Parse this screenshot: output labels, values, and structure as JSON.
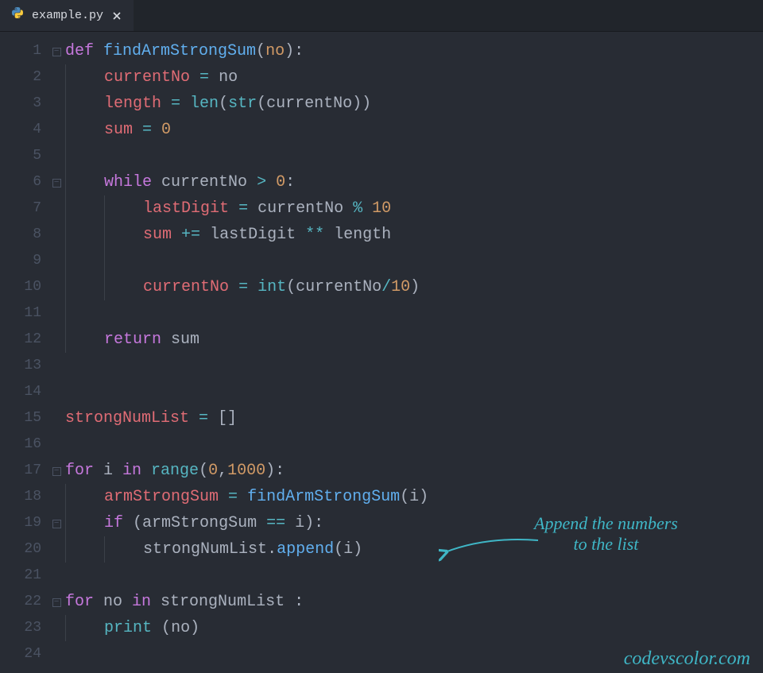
{
  "tab": {
    "filename": "example.py",
    "icon": "python-icon"
  },
  "lineNumbers": [
    "1",
    "2",
    "3",
    "4",
    "5",
    "6",
    "7",
    "8",
    "9",
    "10",
    "11",
    "12",
    "13",
    "14",
    "15",
    "16",
    "17",
    "18",
    "19",
    "20",
    "21",
    "22",
    "23",
    "24"
  ],
  "fold": {
    "l1": true,
    "l6": true,
    "l17": true,
    "l19": true,
    "l22": true
  },
  "code": {
    "l1": {
      "kw_def": "def ",
      "fn": "findArmStrongSum",
      "p_open": "(",
      "prm": "no",
      "p_close": ")",
      "colon": ":"
    },
    "l2": {
      "var": "currentNo",
      "eq": " = ",
      "rhs": "no"
    },
    "l3": {
      "var": "length",
      "eq": " = ",
      "len": "len",
      "p1": "(",
      "str": "str",
      "p2": "(",
      "arg": "currentNo",
      "p3": ")",
      "p4": ")"
    },
    "l4": {
      "var": "sum",
      "eq": " = ",
      "num": "0"
    },
    "l6": {
      "kw": "while ",
      "var": "currentNo",
      "op": " > ",
      "num": "0",
      "colon": ":"
    },
    "l7": {
      "var": "lastDigit",
      "eq": " = ",
      "rhs1": "currentNo",
      "op": " % ",
      "num": "10"
    },
    "l8": {
      "var": "sum",
      "op1": " += ",
      "rhs": "lastDigit",
      "op2": " ** ",
      "rhs2": "length"
    },
    "l10": {
      "var": "currentNo",
      "eq": " = ",
      "int": "int",
      "p1": "(",
      "arg": "currentNo",
      "op": "/",
      "num": "10",
      "p2": ")"
    },
    "l12": {
      "kw": "return ",
      "var": "sum"
    },
    "l15": {
      "var": "strongNumList",
      "eq": " = ",
      "br": "[]"
    },
    "l17": {
      "kw_for": "for ",
      "i": "i",
      "kw_in": " in ",
      "range": "range",
      "p1": "(",
      "a": "0",
      "comma": ",",
      "b": "1000",
      "p2": ")",
      "colon": ":"
    },
    "l18": {
      "var": "armStrongSum",
      "eq": " = ",
      "fn": "findArmStrongSum",
      "p1": "(",
      "arg": "i",
      "p2": ")"
    },
    "l19": {
      "kw": "if ",
      "p1": "(",
      "lhs": "armStrongSum",
      "op": " == ",
      "rhs": "i",
      "p2": ")",
      "colon": ":"
    },
    "l20": {
      "obj": "strongNumList",
      "dot": ".",
      "fn": "append",
      "p1": "(",
      "arg": "i",
      "p2": ")"
    },
    "l22": {
      "kw_for": "for ",
      "var": "no",
      "kw_in": " in ",
      "lst": "strongNumList",
      "sp": " ",
      "colon": ":"
    },
    "l23": {
      "fn": "print",
      "sp": " ",
      "p1": "(",
      "arg": "no",
      "p2": ")"
    }
  },
  "annotation": {
    "line1": "Append the numbers",
    "line2": "to the list"
  },
  "watermark": "codevscolor.com"
}
